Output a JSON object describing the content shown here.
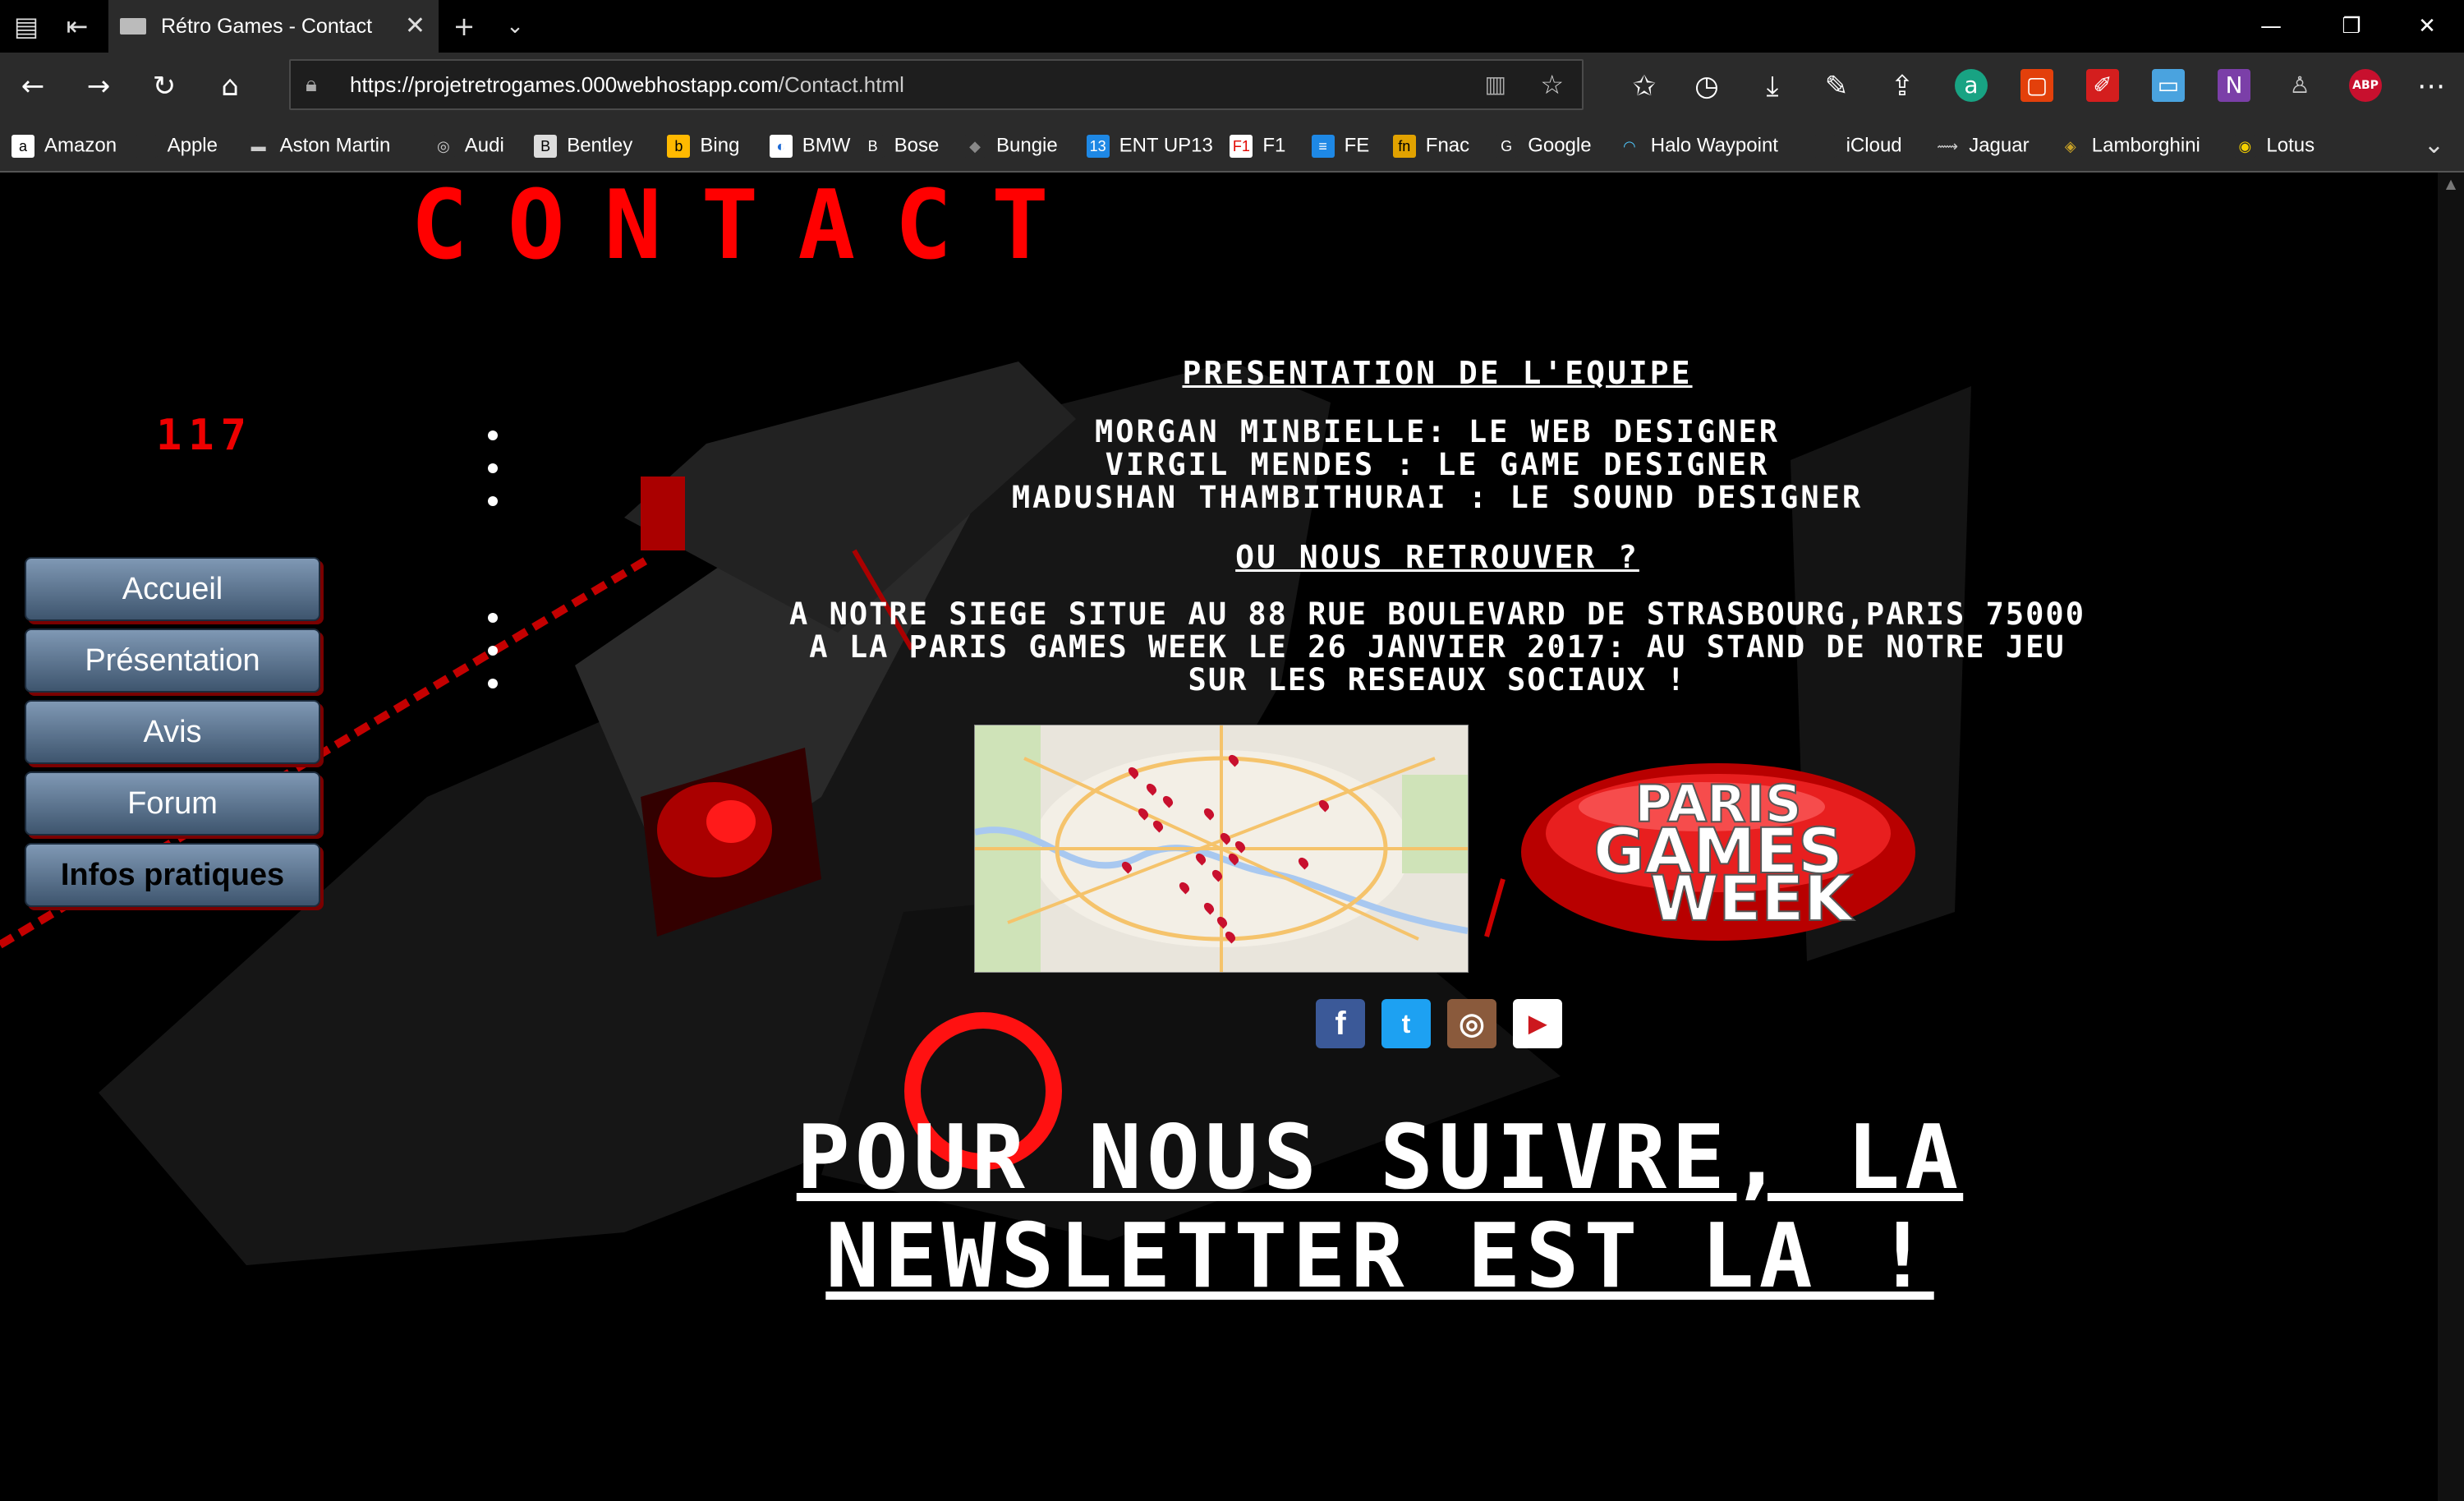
{
  "browser": {
    "tab_title": "Rétro Games - Contact",
    "url_host": "https://projetretrogames.000webhostapp.com",
    "url_path": "/Contact.html",
    "favorites": [
      {
        "label": "Amazon",
        "icon": "amazon-icon"
      },
      {
        "label": "Apple",
        "icon": "apple-icon"
      },
      {
        "label": "Aston Martin",
        "icon": "aston-martin-icon"
      },
      {
        "label": "Audi",
        "icon": "audi-icon"
      },
      {
        "label": "Bentley",
        "icon": "bentley-icon"
      },
      {
        "label": "Bing",
        "icon": "bing-icon"
      },
      {
        "label": "BMW",
        "icon": "bmw-icon"
      },
      {
        "label": "Bose",
        "icon": "bose-icon"
      },
      {
        "label": "Bungie",
        "icon": "bungie-icon"
      },
      {
        "label": "ENT UP13",
        "icon": "ent-icon"
      },
      {
        "label": "F1",
        "icon": "f1-icon"
      },
      {
        "label": "FE",
        "icon": "fe-icon"
      },
      {
        "label": "Fnac",
        "icon": "fnac-icon"
      },
      {
        "label": "Google",
        "icon": "google-icon"
      },
      {
        "label": "Halo Waypoint",
        "icon": "halo-icon"
      },
      {
        "label": "iCloud",
        "icon": "icloud-icon"
      },
      {
        "label": "Jaguar",
        "icon": "jaguar-icon"
      },
      {
        "label": "Lamborghini",
        "icon": "lamborghini-icon"
      },
      {
        "label": "Lotus",
        "icon": "lotus-icon"
      }
    ]
  },
  "page": {
    "title": "CONTACT",
    "counter": "117",
    "menu": [
      "Accueil",
      "Présentation",
      "Avis",
      "Forum",
      "Infos pratiques"
    ],
    "active_menu": "Infos pratiques",
    "team_heading": "Presentation de l'equipe",
    "team": [
      "Morgan Minbielle: le web designer",
      "Virgil Mendes : le game designer",
      "Madushan Thambithurai : le sound designer"
    ],
    "where_heading": "Ou nous retrouver ?",
    "locations": [
      "A notre siege situe au 88 rue Boulevard de Strasbourg,Paris 75000",
      "A la Paris Games Week le 26 janvier 2017: au stand de notre jeu",
      "Sur les reseaux sociaux !"
    ],
    "logo_text": [
      "PARIS",
      "GAMES",
      "WEEK"
    ],
    "socials": [
      {
        "name": "facebook",
        "glyph": "f",
        "color": "#3b5998"
      },
      {
        "name": "twitter",
        "glyph": "t",
        "color": "#1da1f2"
      },
      {
        "name": "instagram",
        "glyph": "◎",
        "color": "#8a5a3c"
      },
      {
        "name": "youtube",
        "glyph": "▶",
        "color": "#cc181e"
      }
    ],
    "newsletter": "Pour nous suivre, la newsletter est la !"
  },
  "colors": {
    "accent": "#ff0000",
    "menu_top": "#7f98b4",
    "menu_bottom": "#3e556e"
  }
}
